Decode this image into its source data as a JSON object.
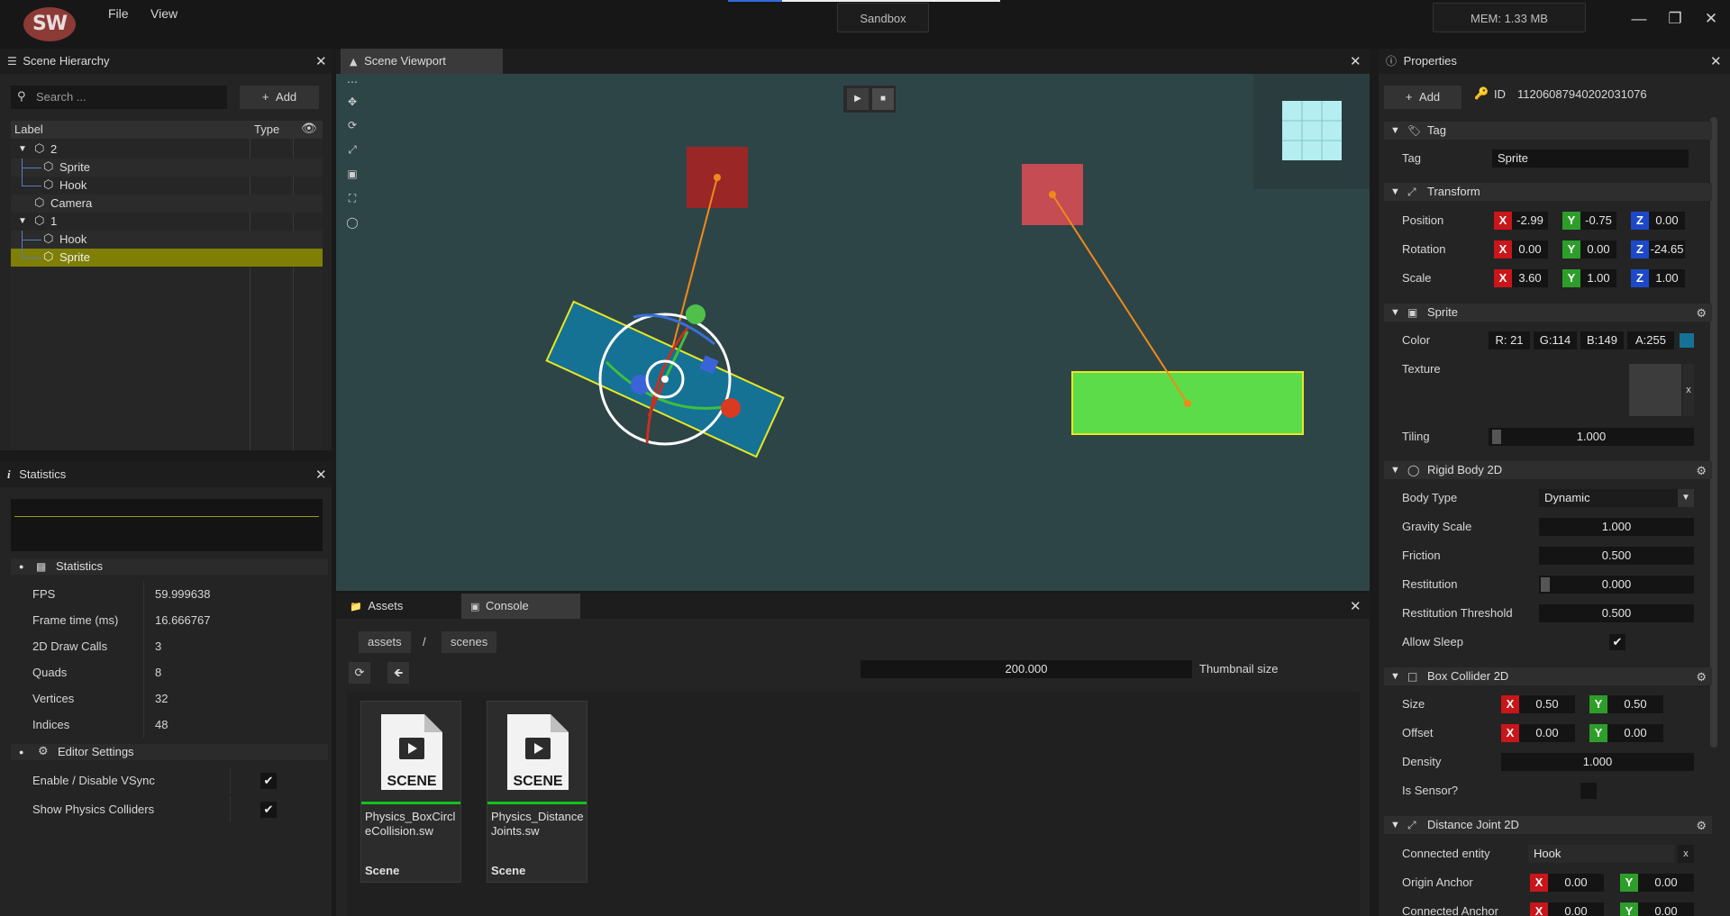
{
  "app": {
    "logo_text": "SW",
    "menu": [
      "File",
      "View"
    ],
    "project_name": "Sandbox",
    "memory": "MEM: 1.33 MB",
    "window_controls": [
      "minimize-icon",
      "maximize-icon",
      "close-icon"
    ]
  },
  "hierarchy": {
    "title": "Scene Hierarchy",
    "search_placeholder": "Search ...",
    "add_label": "Add",
    "columns": [
      "Label",
      "Type"
    ],
    "rows": [
      {
        "label": "2",
        "depth": 0,
        "expanded": true
      },
      {
        "label": "Sprite",
        "depth": 1
      },
      {
        "label": "Hook",
        "depth": 1
      },
      {
        "label": "Camera",
        "depth": 0
      },
      {
        "label": "1",
        "depth": 0,
        "expanded": true
      },
      {
        "label": "Hook",
        "depth": 1
      },
      {
        "label": "Sprite",
        "depth": 1,
        "selected": true
      }
    ]
  },
  "statistics": {
    "title": "Statistics",
    "section_label": "Statistics",
    "rows": [
      {
        "key": "FPS",
        "value": "59.999638"
      },
      {
        "key": "Frame time (ms)",
        "value": "16.666767"
      },
      {
        "key": "2D Draw Calls",
        "value": "3"
      },
      {
        "key": "Quads",
        "value": "8"
      },
      {
        "key": "Vertices",
        "value": "32"
      },
      {
        "key": "Indices",
        "value": "48"
      }
    ],
    "editor_settings_label": "Editor Settings",
    "settings": [
      {
        "key": "Enable / Disable VSync",
        "checked": true
      },
      {
        "key": "Show Physics Colliders",
        "checked": true
      }
    ]
  },
  "viewport": {
    "title": "Scene Viewport",
    "background": "#2e4548"
  },
  "bottom": {
    "tabs": [
      "Assets",
      "Console"
    ],
    "breadcrumb": [
      "assets",
      "/",
      "scenes"
    ],
    "thumbnail_value": "200.000",
    "thumbnail_label": "Thumbnail size",
    "assets": [
      {
        "name": "Physics_BoxCircleCollision.sw",
        "kind": "Scene",
        "thumb_label": "SCENE"
      },
      {
        "name": "Physics_DistanceJoints.sw",
        "kind": "Scene",
        "thumb_label": "SCENE"
      }
    ]
  },
  "properties": {
    "title": "Properties",
    "add_label": "Add",
    "id_label": "ID",
    "id_value": "11206087940202031076",
    "tag": {
      "section": "Tag",
      "label": "Tag",
      "value": "Sprite"
    },
    "transform": {
      "section": "Transform",
      "position": {
        "label": "Position",
        "x": "-2.99",
        "y": "-0.75",
        "z": "0.00"
      },
      "rotation": {
        "label": "Rotation",
        "x": "0.00",
        "y": "0.00",
        "z": "-24.65"
      },
      "scale": {
        "label": "Scale",
        "x": "3.60",
        "y": "1.00",
        "z": "1.00"
      }
    },
    "sprite": {
      "section": "Sprite",
      "color_label": "Color",
      "r": "R: 21",
      "g": "G:114",
      "b": "B:149",
      "a": "A:255",
      "swatch": "#157295",
      "texture_label": "Texture",
      "texture_clear": "x",
      "tiling_label": "Tiling",
      "tiling_value": "1.000"
    },
    "rigidbody": {
      "section": "Rigid Body 2D",
      "body_type_label": "Body Type",
      "body_type_value": "Dynamic",
      "gravity_label": "Gravity Scale",
      "gravity_value": "1.000",
      "friction_label": "Friction",
      "friction_value": "0.500",
      "restitution_label": "Restitution",
      "restitution_value": "0.000",
      "threshold_label": "Restitution Threshold",
      "threshold_value": "0.500",
      "sleep_label": "Allow Sleep",
      "sleep_checked": true
    },
    "boxcollider": {
      "section": "Box Collider 2D",
      "size_label": "Size",
      "size_x": "0.50",
      "size_y": "0.50",
      "offset_label": "Offset",
      "offset_x": "0.00",
      "offset_y": "0.00",
      "density_label": "Density",
      "density_value": "1.000",
      "sensor_label": "Is Sensor?"
    },
    "distancejoint": {
      "section": "Distance Joint 2D",
      "connected_label": "Connected entity",
      "connected_value": "Hook",
      "connected_clear": "x",
      "origin_label": "Origin Anchor",
      "origin_x": "0.00",
      "origin_y": "0.00",
      "conn_anchor_label": "Connected Anchor",
      "conn_x": "0.00",
      "conn_y": "0.00"
    }
  }
}
